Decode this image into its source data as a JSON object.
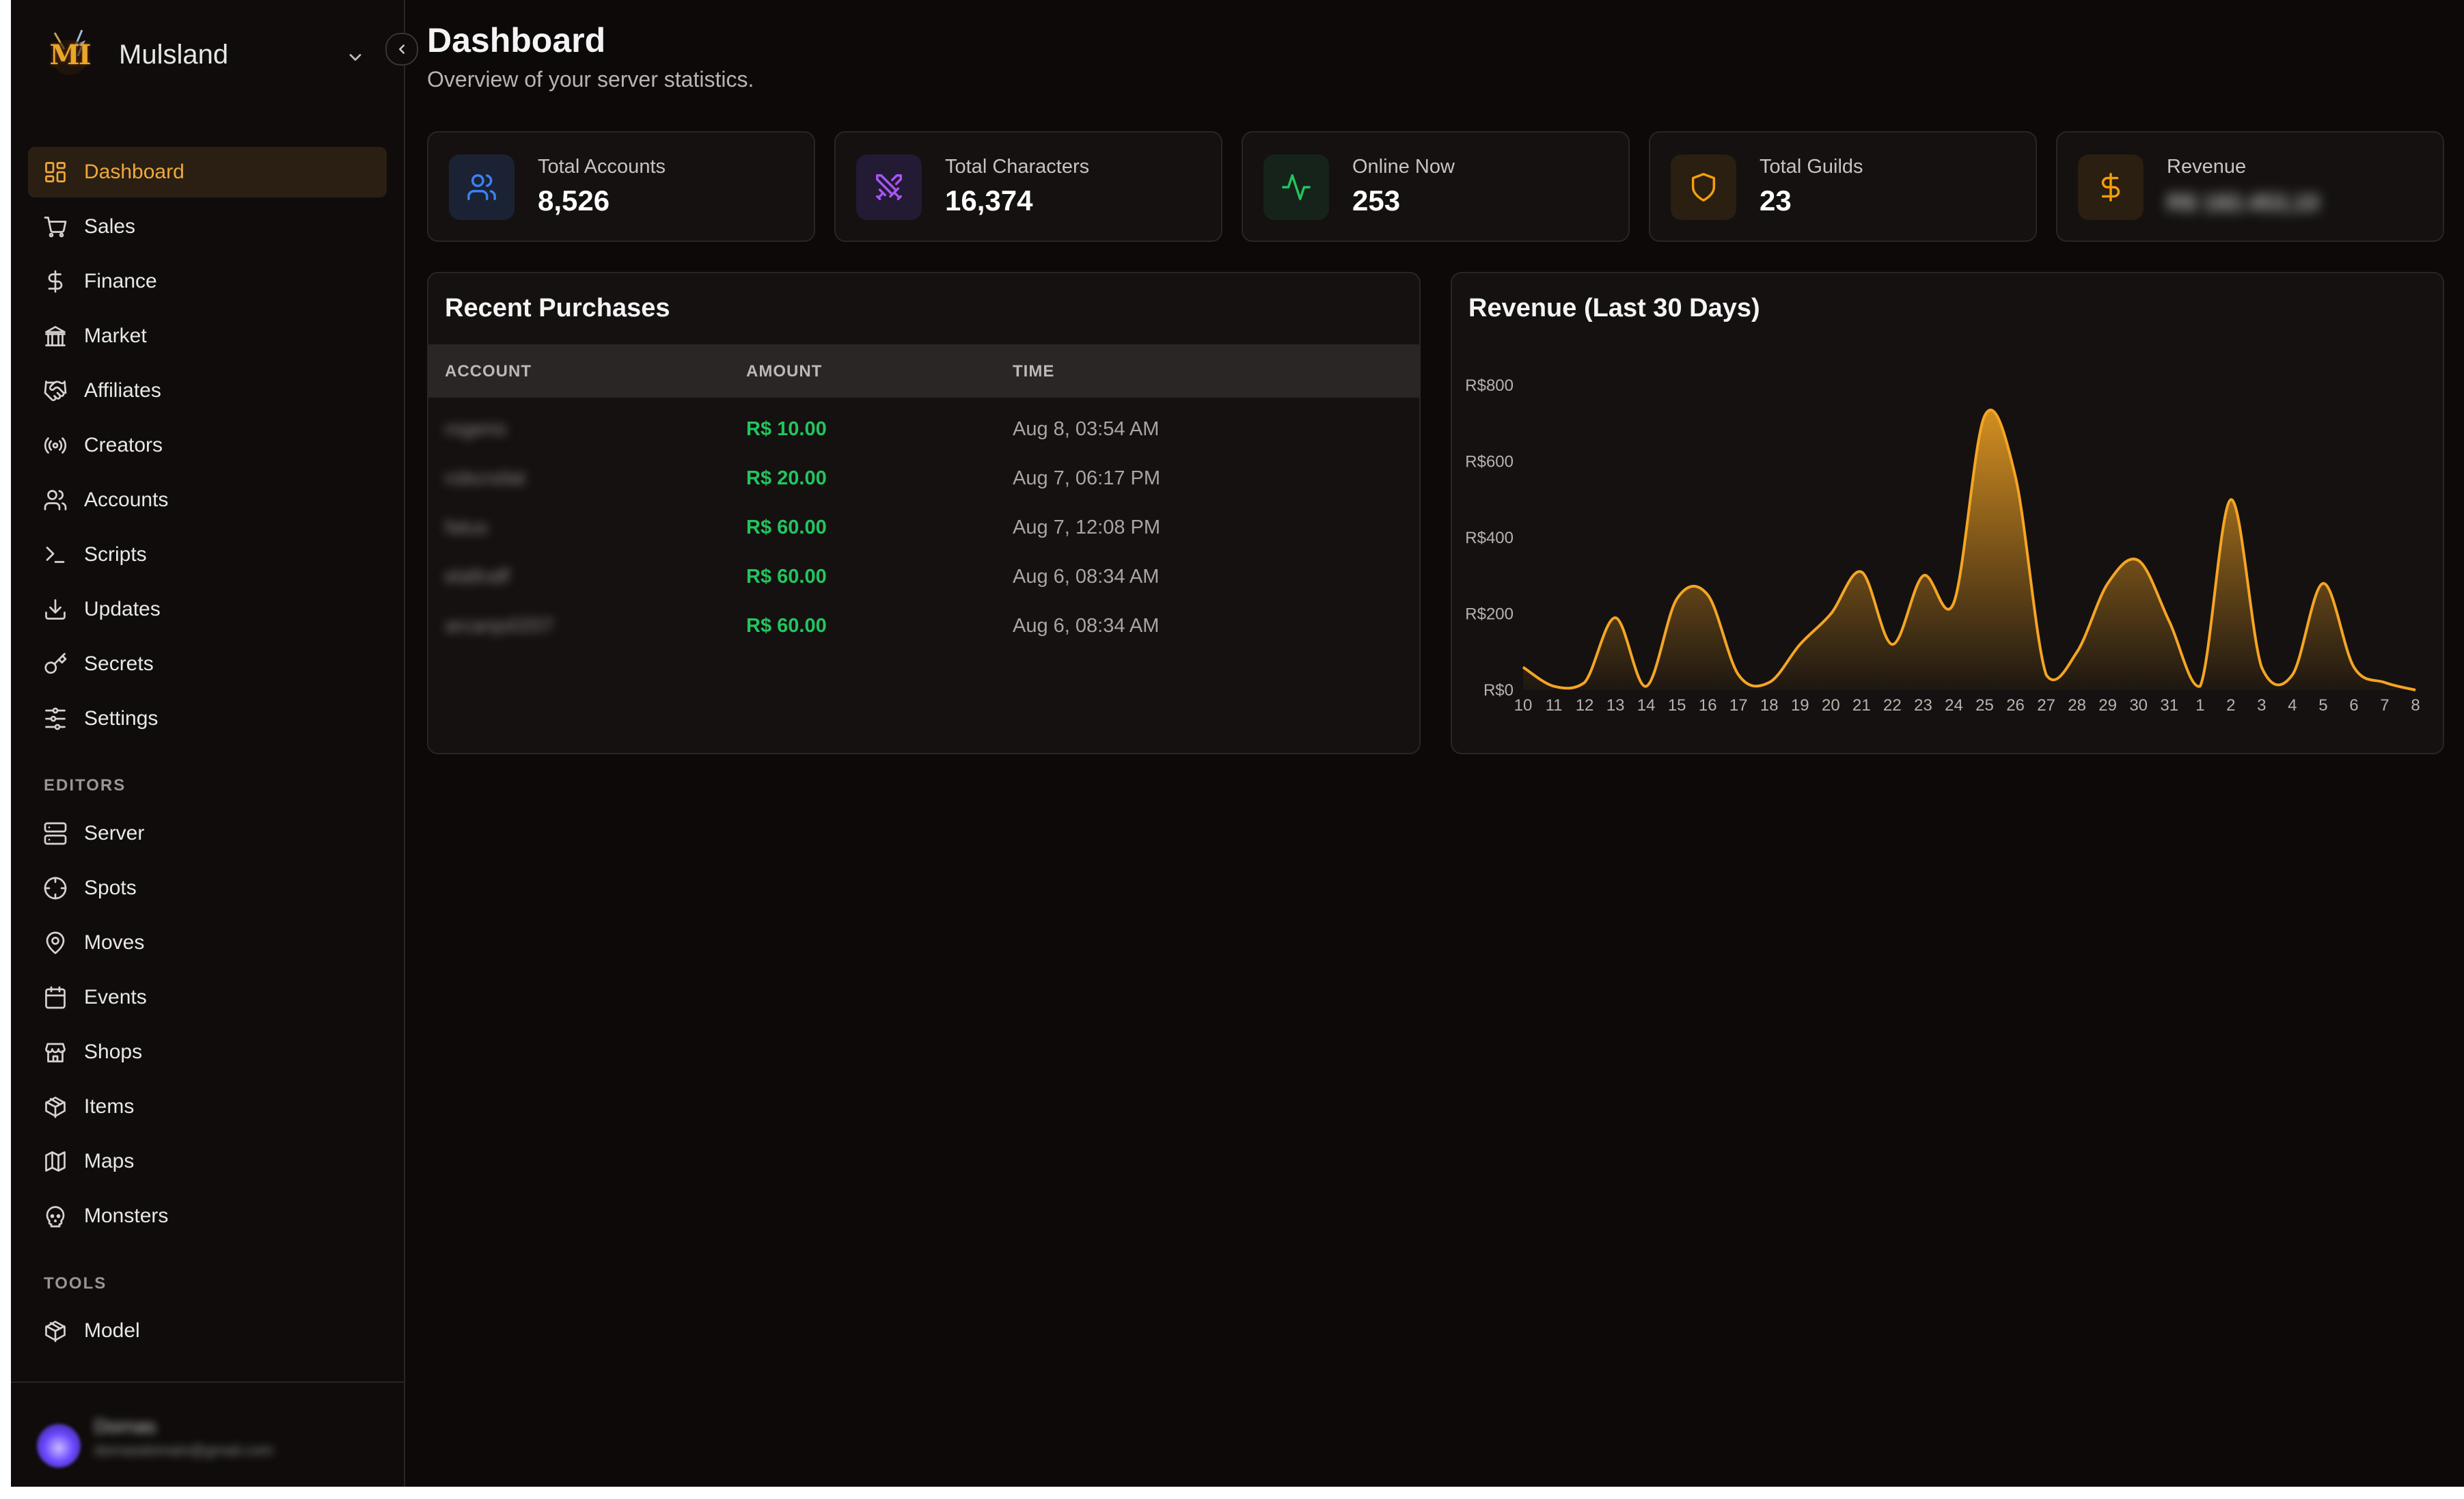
{
  "brand": {
    "name": "Mulsland",
    "logo_text": "MI"
  },
  "nav": {
    "main": [
      {
        "key": "dashboard",
        "label": "Dashboard",
        "icon": "dashboard-icon",
        "active": true
      },
      {
        "key": "sales",
        "label": "Sales",
        "icon": "cart-icon"
      },
      {
        "key": "finance",
        "label": "Finance",
        "icon": "dollar-icon"
      },
      {
        "key": "market",
        "label": "Market",
        "icon": "bank-icon"
      },
      {
        "key": "affiliates",
        "label": "Affiliates",
        "icon": "handshake-icon"
      },
      {
        "key": "creators",
        "label": "Creators",
        "icon": "broadcast-icon"
      },
      {
        "key": "accounts",
        "label": "Accounts",
        "icon": "users-icon"
      },
      {
        "key": "scripts",
        "label": "Scripts",
        "icon": "terminal-icon"
      },
      {
        "key": "updates",
        "label": "Updates",
        "icon": "download-icon"
      },
      {
        "key": "secrets",
        "label": "Secrets",
        "icon": "key-icon"
      },
      {
        "key": "settings",
        "label": "Settings",
        "icon": "sliders-icon"
      }
    ],
    "editors_title": "EDITORS",
    "editors": [
      {
        "key": "server",
        "label": "Server",
        "icon": "server-icon"
      },
      {
        "key": "spots",
        "label": "Spots",
        "icon": "crosshair-icon"
      },
      {
        "key": "moves",
        "label": "Moves",
        "icon": "map-pin-icon"
      },
      {
        "key": "events",
        "label": "Events",
        "icon": "calendar-icon"
      },
      {
        "key": "shops",
        "label": "Shops",
        "icon": "store-icon"
      },
      {
        "key": "items",
        "label": "Items",
        "icon": "package-icon"
      },
      {
        "key": "maps",
        "label": "Maps",
        "icon": "map-icon"
      },
      {
        "key": "monsters",
        "label": "Monsters",
        "icon": "skull-icon"
      }
    ],
    "tools_title": "TOOLS",
    "tools": [
      {
        "key": "model",
        "label": "Model",
        "icon": "package-icon"
      }
    ]
  },
  "user": {
    "name": "Dornas",
    "email": "dornasdomain@gmail.com"
  },
  "header": {
    "title": "Dashboard",
    "subtitle": "Overview of your server statistics."
  },
  "stats": [
    {
      "label": "Total Accounts",
      "value": "8,526",
      "icon": "users-icon",
      "color": "#3b82f6",
      "bg": "#1b2233"
    },
    {
      "label": "Total Characters",
      "value": "16,374",
      "icon": "crossed-swords-icon",
      "color": "#a855f7",
      "bg": "#231a33"
    },
    {
      "label": "Online Now",
      "value": "253",
      "icon": "activity-icon",
      "color": "#22c55e",
      "bg": "#16231a"
    },
    {
      "label": "Total Guilds",
      "value": "23",
      "icon": "shield-icon",
      "color": "#f59e0b",
      "bg": "#2a1f10"
    },
    {
      "label": "Revenue",
      "value": "R$ 182.453,10",
      "icon": "dollar-icon",
      "color": "#f59e0b",
      "bg": "#2a1f10",
      "blurred": true
    }
  ],
  "purchases": {
    "title": "Recent Purchases",
    "columns": [
      "ACCOUNT",
      "AMOUNT",
      "TIME"
    ],
    "rows": [
      {
        "account": "rogerio",
        "amount": "R$ 10.00",
        "time": "Aug 8, 03:54 AM"
      },
      {
        "account": "robcrsilat",
        "amount": "R$ 20.00",
        "time": "Aug 7, 06:17 PM"
      },
      {
        "account": "fatus",
        "amount": "R$ 60.00",
        "time": "Aug 7, 12:08 PM"
      },
      {
        "account": "elafiraff",
        "amount": "R$ 60.00",
        "time": "Aug 6, 08:34 AM"
      },
      {
        "account": "arcanjo0207",
        "amount": "R$ 60.00",
        "time": "Aug 6, 08:34 AM"
      }
    ]
  },
  "chart_data": {
    "type": "area",
    "title": "Revenue (Last 30 Days)",
    "xlabel": "",
    "ylabel": "",
    "y_ticks": [
      "R$0",
      "R$200",
      "R$400",
      "R$600",
      "R$800"
    ],
    "ylim": [
      0,
      800
    ],
    "x": [
      "10",
      "11",
      "12",
      "13",
      "14",
      "15",
      "16",
      "17",
      "18",
      "19",
      "20",
      "21",
      "22",
      "23",
      "24",
      "25",
      "26",
      "27",
      "28",
      "29",
      "30",
      "31",
      "1",
      "2",
      "3",
      "4",
      "5",
      "6",
      "7",
      "8"
    ],
    "series": [
      {
        "values": [
          60,
          10,
          20,
          190,
          10,
          240,
          250,
          40,
          20,
          120,
          200,
          310,
          120,
          300,
          230,
          720,
          560,
          40,
          100,
          280,
          340,
          180,
          10,
          500,
          60,
          40,
          280,
          60,
          20,
          0
        ]
      }
    ],
    "color": "#f5a524",
    "grid": false,
    "legend": "none"
  },
  "colors": {
    "accent": "#f0a93a",
    "background": "#0c0908",
    "panel": "#141110",
    "success": "#22c55e"
  }
}
